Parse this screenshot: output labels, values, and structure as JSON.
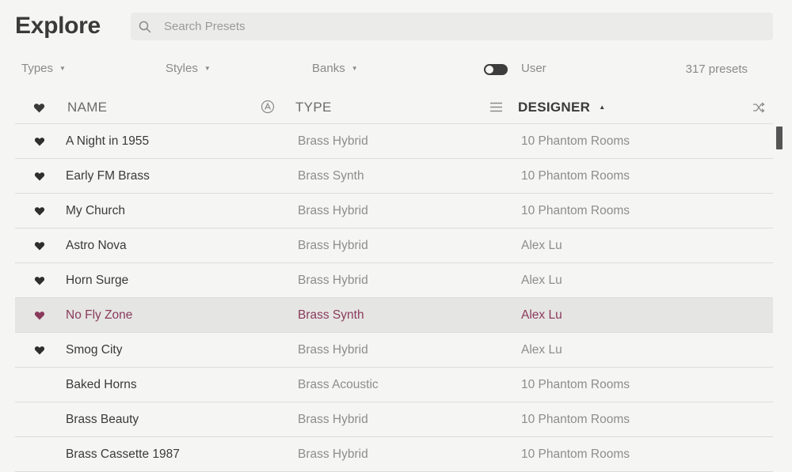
{
  "page": {
    "title": "Explore"
  },
  "search": {
    "placeholder": "Search Presets",
    "value": ""
  },
  "filters": {
    "types_label": "Types",
    "styles_label": "Styles",
    "banks_label": "Banks",
    "user_label": "User",
    "user_toggle_on": true,
    "preset_count": "317 presets"
  },
  "columns": {
    "name": "NAME",
    "type": "TYPE",
    "designer": "DESIGNER",
    "sort_indicator": "▲"
  },
  "colors": {
    "accent": "#8a3a5c",
    "selected_row_bg": "#e5e5e3"
  },
  "presets": [
    {
      "favorite": true,
      "name": "A Night in 1955",
      "type": "Brass Hybrid",
      "designer": "10 Phantom Rooms",
      "selected": false
    },
    {
      "favorite": true,
      "name": "Early FM Brass",
      "type": "Brass Synth",
      "designer": "10 Phantom Rooms",
      "selected": false
    },
    {
      "favorite": true,
      "name": "My Church",
      "type": "Brass Hybrid",
      "designer": "10 Phantom Rooms",
      "selected": false
    },
    {
      "favorite": true,
      "name": "Astro Nova",
      "type": "Brass Hybrid",
      "designer": "Alex Lu",
      "selected": false
    },
    {
      "favorite": true,
      "name": "Horn Surge",
      "type": "Brass Hybrid",
      "designer": "Alex Lu",
      "selected": false
    },
    {
      "favorite": true,
      "name": "No Fly Zone",
      "type": "Brass Synth",
      "designer": "Alex Lu",
      "selected": true
    },
    {
      "favorite": true,
      "name": "Smog City",
      "type": "Brass Hybrid",
      "designer": "Alex Lu",
      "selected": false
    },
    {
      "favorite": false,
      "name": "Baked Horns",
      "type": "Brass Acoustic",
      "designer": "10 Phantom Rooms",
      "selected": false
    },
    {
      "favorite": false,
      "name": "Brass Beauty",
      "type": "Brass Hybrid",
      "designer": "10 Phantom Rooms",
      "selected": false
    },
    {
      "favorite": false,
      "name": "Brass Cassette 1987",
      "type": "Brass Hybrid",
      "designer": "10 Phantom Rooms",
      "selected": false
    }
  ]
}
